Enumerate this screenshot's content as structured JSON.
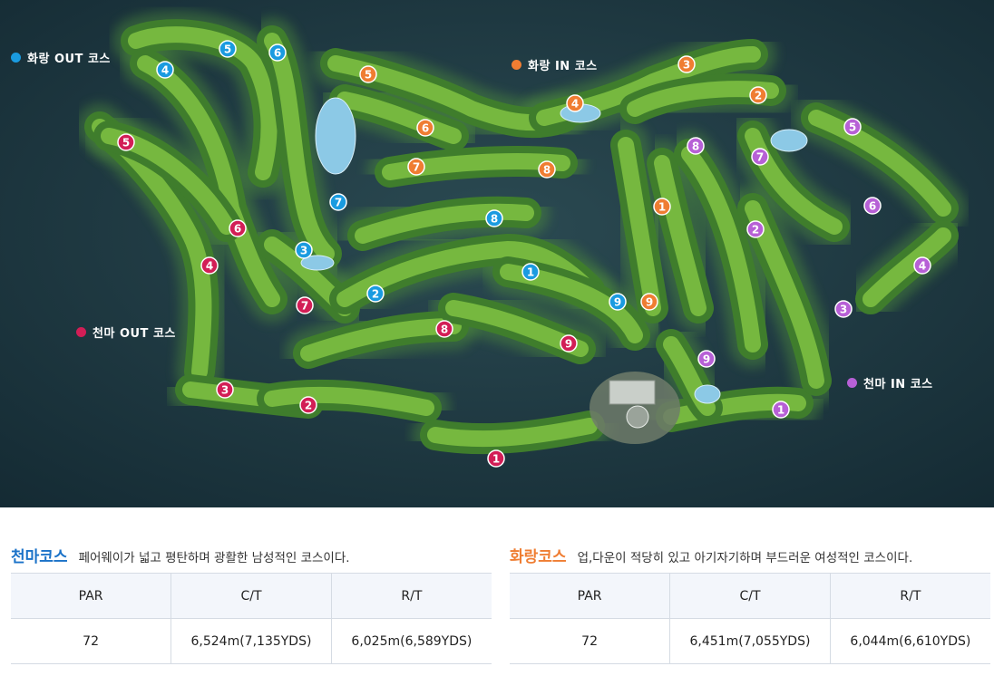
{
  "map": {
    "course_labels": {
      "hwarang_out": "화랑 OUT 코스",
      "hwarang_in": "화랑 IN 코스",
      "cheonma_out": "천마 OUT 코스",
      "cheonma_in": "천마 IN 코스"
    },
    "colors": {
      "hwarang_out": "#1a9be0",
      "hwarang_in": "#ef7d32",
      "cheonma_out": "#d21e56",
      "cheonma_in": "#b760d6"
    },
    "hole_numbers": [
      "1",
      "2",
      "3",
      "4",
      "5",
      "6",
      "7",
      "8",
      "9"
    ]
  },
  "cheonma": {
    "title": "천마코스",
    "description": "페어웨이가 넓고 평탄하며 광활한 남성적인 코스이다.",
    "headers": [
      "PAR",
      "C/T",
      "R/T"
    ],
    "row": [
      "72",
      "6,524m(7,135YDS)",
      "6,025m(6,589YDS)"
    ]
  },
  "hwarang": {
    "title": "화랑코스",
    "description": "업,다운이 적당히 있고 아기자기하며 부드러운 여성적인 코스이다.",
    "headers": [
      "PAR",
      "C/T",
      "R/T"
    ],
    "row": [
      "72",
      "6,451m(7,055YDS)",
      "6,044m(6,610YDS)"
    ]
  }
}
